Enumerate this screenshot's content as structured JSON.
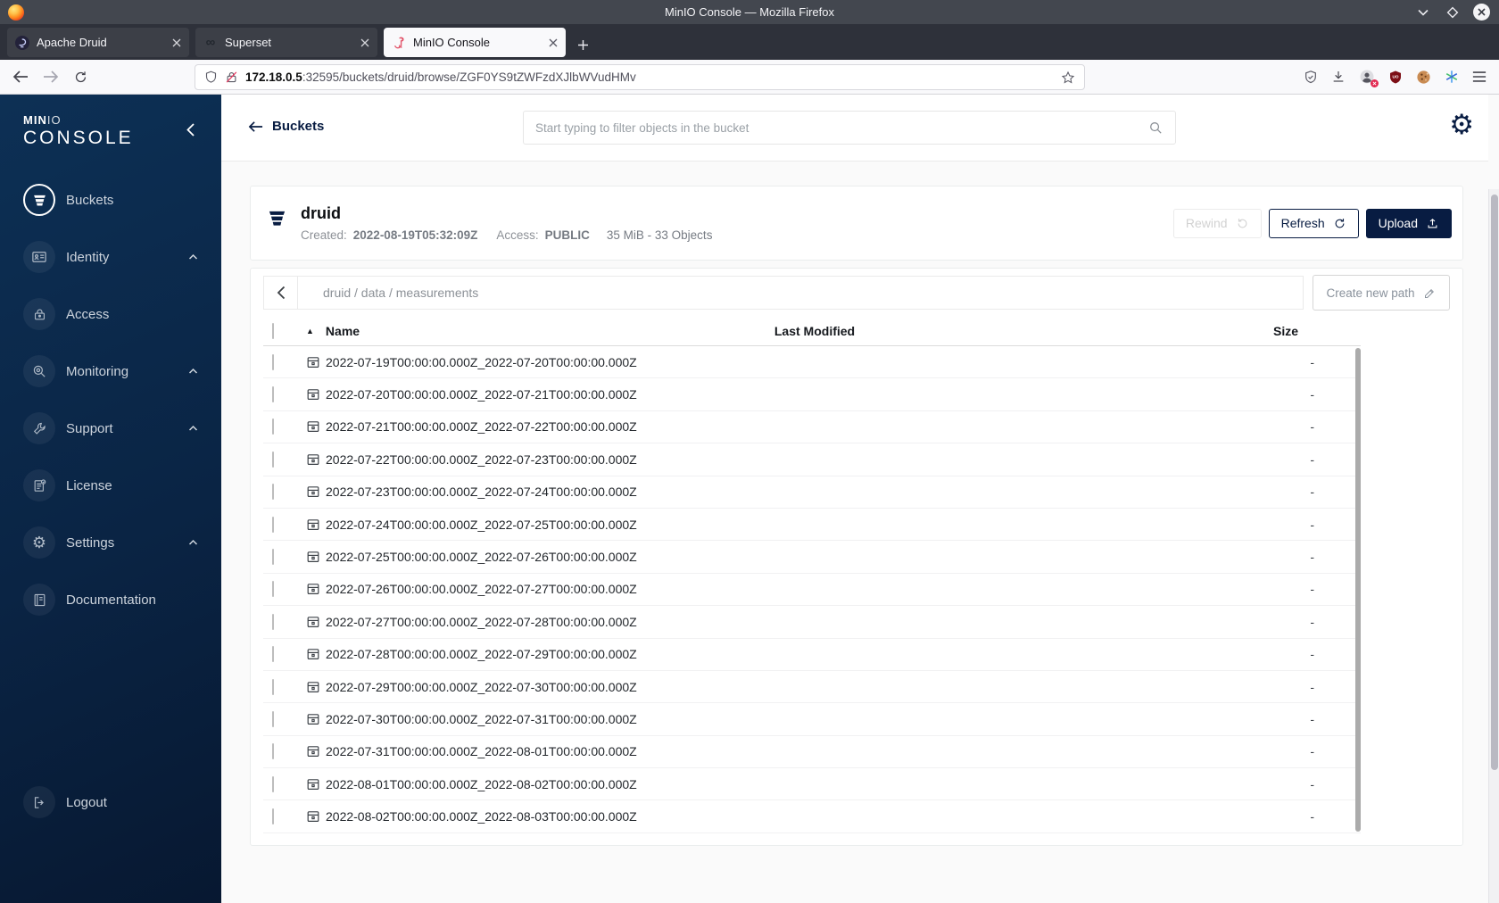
{
  "browser": {
    "window_title": "MinIO Console — Mozilla Firefox",
    "tabs": [
      {
        "label": "Apache Druid"
      },
      {
        "label": "Superset"
      },
      {
        "label": "MinIO Console"
      }
    ],
    "url": {
      "host": "172.18.0.5",
      "path": ":32595/buckets/druid/browse/ZGF0YS9tZWFzdXJlbWVudHMv"
    }
  },
  "sidebar": {
    "logo": {
      "min": "MIN",
      "io": "IO",
      "console": "CONSOLE"
    },
    "items": [
      {
        "label": "Buckets"
      },
      {
        "label": "Identity"
      },
      {
        "label": "Access"
      },
      {
        "label": "Monitoring"
      },
      {
        "label": "Support"
      },
      {
        "label": "License"
      },
      {
        "label": "Settings"
      },
      {
        "label": "Documentation"
      }
    ],
    "logout": "Logout"
  },
  "header": {
    "back_label": "Buckets",
    "search_placeholder": "Start typing to filter objects in the bucket"
  },
  "bucket": {
    "name": "druid",
    "created_label": "Created:",
    "created": "2022-08-19T05:32:09Z",
    "access_label": "Access:",
    "access": "PUBLIC",
    "summary": "35 MiB - 33 Objects",
    "rewind": "Rewind",
    "refresh": "Refresh",
    "upload": "Upload"
  },
  "browse": {
    "path": "druid / data / measurements",
    "create_path": "Create new path",
    "columns": {
      "name": "Name",
      "last_modified": "Last Modified",
      "size": "Size"
    },
    "rows": [
      {
        "name": "2022-07-19T00:00:00.000Z_2022-07-20T00:00:00.000Z",
        "size": "-"
      },
      {
        "name": "2022-07-20T00:00:00.000Z_2022-07-21T00:00:00.000Z",
        "size": "-"
      },
      {
        "name": "2022-07-21T00:00:00.000Z_2022-07-22T00:00:00.000Z",
        "size": "-"
      },
      {
        "name": "2022-07-22T00:00:00.000Z_2022-07-23T00:00:00.000Z",
        "size": "-"
      },
      {
        "name": "2022-07-23T00:00:00.000Z_2022-07-24T00:00:00.000Z",
        "size": "-"
      },
      {
        "name": "2022-07-24T00:00:00.000Z_2022-07-25T00:00:00.000Z",
        "size": "-"
      },
      {
        "name": "2022-07-25T00:00:00.000Z_2022-07-26T00:00:00.000Z",
        "size": "-"
      },
      {
        "name": "2022-07-26T00:00:00.000Z_2022-07-27T00:00:00.000Z",
        "size": "-"
      },
      {
        "name": "2022-07-27T00:00:00.000Z_2022-07-28T00:00:00.000Z",
        "size": "-"
      },
      {
        "name": "2022-07-28T00:00:00.000Z_2022-07-29T00:00:00.000Z",
        "size": "-"
      },
      {
        "name": "2022-07-29T00:00:00.000Z_2022-07-30T00:00:00.000Z",
        "size": "-"
      },
      {
        "name": "2022-07-30T00:00:00.000Z_2022-07-31T00:00:00.000Z",
        "size": "-"
      },
      {
        "name": "2022-07-31T00:00:00.000Z_2022-08-01T00:00:00.000Z",
        "size": "-"
      },
      {
        "name": "2022-08-01T00:00:00.000Z_2022-08-02T00:00:00.000Z",
        "size": "-"
      },
      {
        "name": "2022-08-02T00:00:00.000Z_2022-08-03T00:00:00.000Z",
        "size": "-"
      }
    ]
  },
  "colors": {
    "navy": "#081C42",
    "page_bg": "#FAFAFA",
    "card_border": "#EAEDED",
    "sidebar_gradient_start": "#0D3055",
    "sidebar_gradient_end": "#071831",
    "titlebar": "#43474F",
    "tabbar": "#2E313A",
    "toolbar": "#F9F9FB",
    "disabled_text": "#D2D2D2"
  }
}
